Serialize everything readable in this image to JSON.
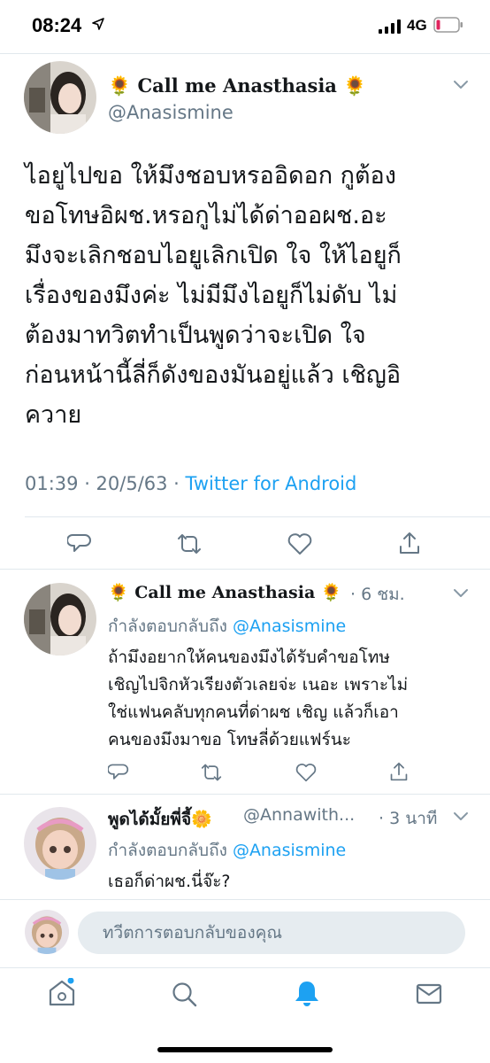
{
  "status_bar": {
    "time": "08:24",
    "network": "4G"
  },
  "main_tweet": {
    "display_name": "🌻 Call me Anasthasia 🌻",
    "handle": "@Anasismine",
    "text_lines": [
      "ไอยูไปขอ ให้มึงชอบหรออิดอก กูต้อง",
      "ขอโทษอิผช.หรอกูไม่ได้ด่าออผช.อะ",
      "มึงจะเลิกชอบไอยูเลิกเปิด ใจ ให้ไอยูก็",
      "เรื่องของมึงค่ะ ไม่มีมึงไอยูก็ไม่ดับ ไม่",
      "ต้องมาทวิตทำเป็นพูดว่าจะเปิด ใจ",
      "ก่อนหน้านี้ลี่ก็ดังของมันอยู่แล้ว เชิญอิ",
      "ควาย"
    ],
    "timestamp": "01:39 · 20/5/63 · ",
    "source": "Twitter for Android"
  },
  "reply1": {
    "display_name": "🌻 Call me Anasthasia 🌻",
    "time": "· 6 ชม.",
    "replying_to_label": "กำลังตอบกลับถึง ",
    "replying_to_handle": "@Anasismine",
    "text_lines": [
      "ถ้ามึงอยากให้คนของมึงได้รับคำขอโทษ",
      "เชิญไปจิกหัวเรียงตัวเลยจ่ะ เนอะ เพราะไม่",
      "ใช่แฟนคลับทุกคนที่ด่าผช เชิญ แล้วก็เอา",
      "คนของมึงมาขอ โทษลี่ด้วยแฟร์นะ"
    ]
  },
  "reply2": {
    "display_name": "พูดได้มั้ยพี่จี้🌼",
    "handle": "@Annawith...",
    "time": "· 3 นาที",
    "replying_to_label": "กำลังตอบกลับถึง ",
    "replying_to_handle": "@Anasismine",
    "text_lines": [
      "เธอก็ด่าผช.นี่จ๊ะ?"
    ]
  },
  "compose": {
    "placeholder": "ทวีตการตอบกลับของคุณ"
  },
  "colors": {
    "accent": "#1da1f2",
    "secondary_text": "#657786",
    "battery_low": "#e0245e"
  },
  "icons": {
    "actions": [
      "reply-icon",
      "retweet-icon",
      "like-icon",
      "share-icon"
    ],
    "tabbar": [
      "home-icon",
      "search-icon",
      "notifications-icon",
      "messages-icon"
    ]
  }
}
